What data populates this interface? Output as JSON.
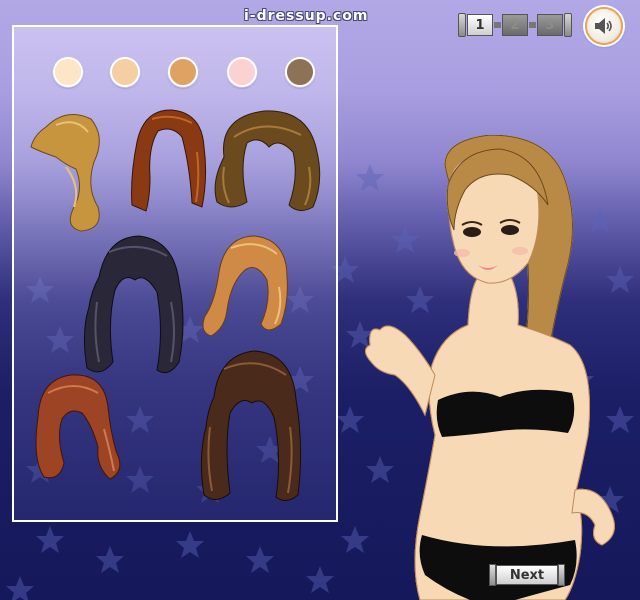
{
  "site": {
    "logo_text": "i-dressup.com"
  },
  "pager": {
    "pages": [
      "1",
      "2",
      "3"
    ],
    "active": "1"
  },
  "sound": {
    "icon": "speaker-icon"
  },
  "panel": {
    "skin_swatches": [
      {
        "name": "pale",
        "color": "#fde6c8"
      },
      {
        "name": "light",
        "color": "#f3cfa3"
      },
      {
        "name": "tan",
        "color": "#e0a263"
      },
      {
        "name": "pink",
        "color": "#fbd2d2"
      },
      {
        "name": "brown",
        "color": "#8c7256"
      }
    ],
    "hairstyles": [
      {
        "name": "honey-side-ponytail",
        "color": "#c8953f"
      },
      {
        "name": "auburn-long-straight",
        "color": "#8a3a12"
      },
      {
        "name": "brown-wavy-bob",
        "color": "#6b4a1e"
      },
      {
        "name": "black-long-curly",
        "color": "#2a2838"
      },
      {
        "name": "caramel-medium-flip",
        "color": "#cf8a45"
      },
      {
        "name": "red-side-swept",
        "color": "#9c4424"
      },
      {
        "name": "dark-brown-long-waves",
        "color": "#4a2a1a"
      }
    ]
  },
  "model": {
    "hair_color": "#b98a45",
    "top_color": "#111111",
    "bottom_color": "#111111",
    "skin_color": "#f7d9b5"
  },
  "next_button": {
    "label": "Next"
  }
}
